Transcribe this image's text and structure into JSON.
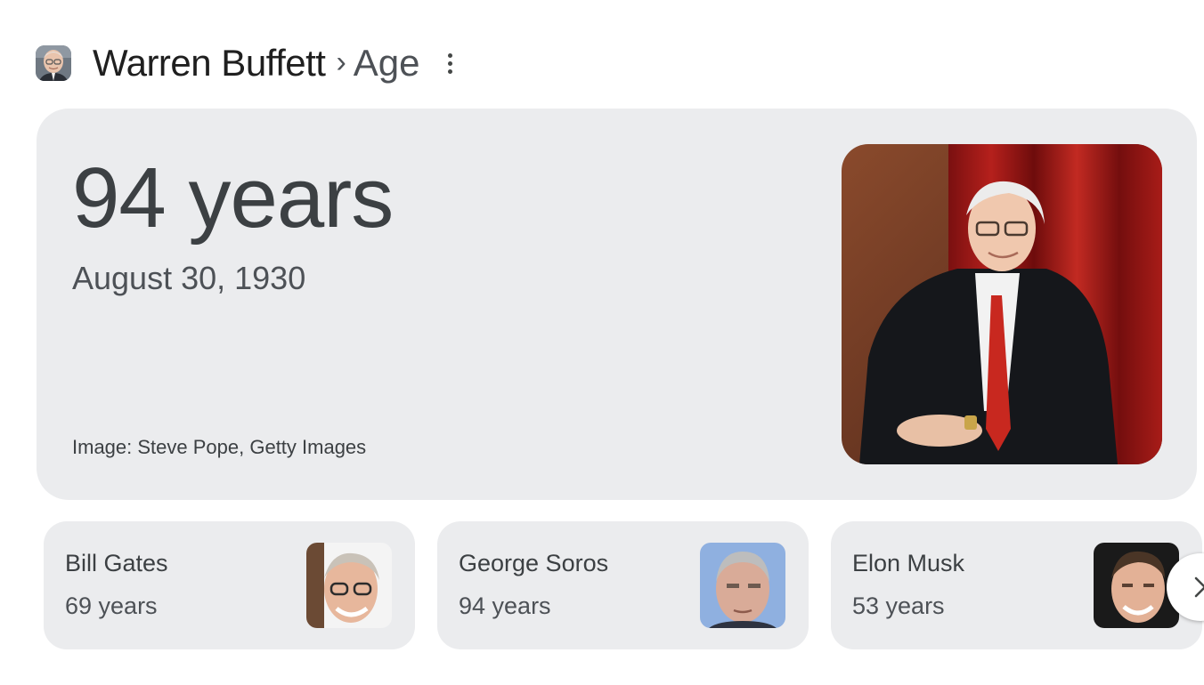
{
  "header": {
    "entity": "Warren Buffett",
    "separator": "›",
    "attribute": "Age"
  },
  "answer": {
    "value": "94 years",
    "date": "August 30, 1930",
    "image_credit": "Image: Steve Pope, Getty Images"
  },
  "related": [
    {
      "name": "Bill Gates",
      "age": "69 years"
    },
    {
      "name": "George Soros",
      "age": "94 years"
    },
    {
      "name": "Elon Musk",
      "age": "53 years"
    }
  ],
  "icons": {
    "more": "more-vert-icon",
    "next": "chevron-right-icon"
  },
  "colors": {
    "card_background": "#ebecee",
    "primary_text": "#1f1f1f",
    "secondary_text": "#4d5156"
  }
}
